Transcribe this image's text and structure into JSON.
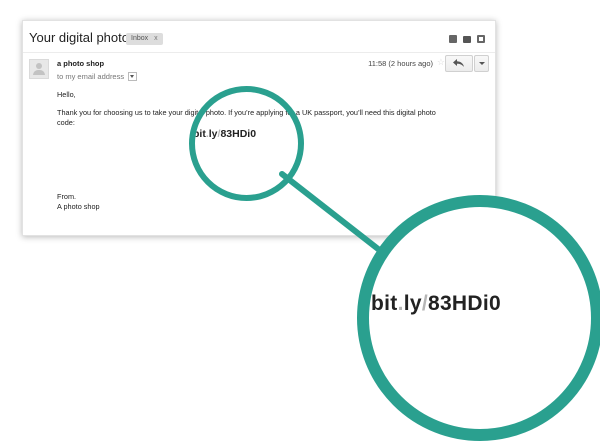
{
  "email": {
    "subject": "Your digital photo",
    "label": "Inbox",
    "label_close": "x",
    "sender": "a photo shop",
    "recipient": "to my email address",
    "timestamp": "11:58 (2 hours ago)",
    "star": "☆",
    "greeting": "Hello,",
    "paragraph_line1": "Thank you for choosing us to take your digital photo. If you’re applying for a UK passport, you’ll need this digital photo",
    "paragraph_line2": "code:",
    "signoff": "From.",
    "signature": "A photo shop"
  },
  "code": {
    "part1": "bit",
    "sep1": ".",
    "part2": "ly",
    "sep2": "/",
    "part3": "83HDi0"
  },
  "colors": {
    "accent": "#2aa08f",
    "separator": "#b5b5b5"
  },
  "icons": [
    "archive-icon",
    "print-icon",
    "new-window-icon",
    "reply-icon",
    "more-options-icon",
    "star-icon",
    "avatar-icon"
  ]
}
